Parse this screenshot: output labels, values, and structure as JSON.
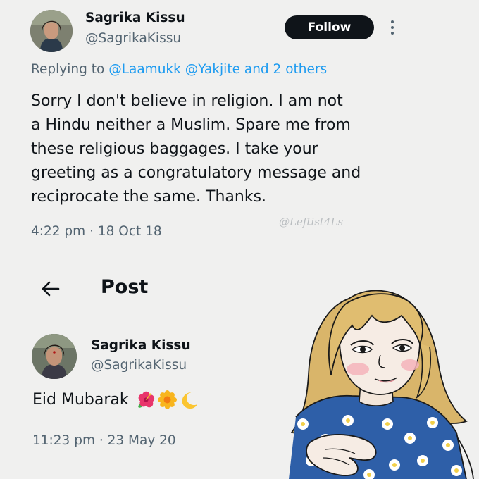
{
  "tweet1": {
    "display_name": "Sagrika Kissu",
    "handle": "@SagrikaKissu",
    "follow_label": "Follow",
    "reply_prefix": "Replying to",
    "reply_mentions": "@Laamukk @Yakjite",
    "reply_suffix": "and 2 others",
    "text_lines": [
      "Sorry I don't believe in religion. I am not",
      "a Hindu neither a Muslim. Spare me from",
      "these religious baggages. I take your",
      "greeting as a congratulatory message and",
      "reciprocate the same. Thanks."
    ],
    "timestamp": "4:22 pm · 18 Oct 18"
  },
  "watermark": "@Leftist4Ls",
  "post_header": {
    "title": "Post",
    "back_icon": "arrow-left-icon"
  },
  "tweet2": {
    "display_name": "Sagrika Kissu",
    "handle": "@SagrikaKissu",
    "text": "Eid Mubarak",
    "emojis": [
      "hibiscus-emoji",
      "blossom-emoji",
      "crescent-moon-emoji"
    ],
    "timestamp": "11:23 pm · 23 May 20"
  },
  "colors": {
    "background": "#f0f0ef",
    "text": "#0f1419",
    "secondary": "#536471",
    "link": "#1d9bf0",
    "button": "#0f1419"
  }
}
